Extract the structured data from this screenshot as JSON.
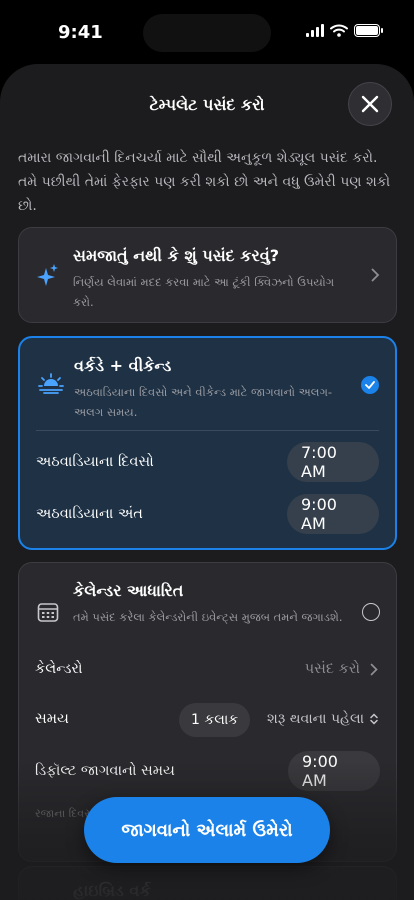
{
  "status_bar": {
    "time": "9:41"
  },
  "sheet": {
    "title": "ટેમ્પલેટ પસંદ કરો",
    "description": "તમારા જાગવાની દિનચર્યા માટે સૌથી અનુકૂળ શેડ્યૂલ પસંદ કરો. તમે પછીથી તેમાં ફેરફાર પણ કરી શકો છો અને વધુ ઉમેરી પણ શકો છો."
  },
  "cards": {
    "help": {
      "title": "સમજાતું નથી કે શું પસંદ કરવું?",
      "subtitle": "નિર્ણય લેવામાં મદદ કરવા માટે આ ટૂંકી ક્વિઝનો ઉપયોગ કરો."
    },
    "weekday": {
      "title": "વર્કડે + વીકેન્ડ",
      "subtitle": "અઠવાડિયાના દિવસો અને વીકેન્ડ માટે જાગવાનો અલગ-અલગ સમય.",
      "rows": [
        {
          "label": "અઠવાડિયાના દિવસો",
          "value": "7:00 AM"
        },
        {
          "label": "અઠવાડિયાના અંત",
          "value": "9:00 AM"
        }
      ]
    },
    "calendar": {
      "title": "કેલેન્ડર આધારિત",
      "subtitle": "તમે પસંદ કરેલા કેલેન્ડરોની ઇવેન્ટ્સ મુજબ તમને જગાડશે.",
      "calendars_label": "કેલેન્ડરો",
      "calendars_value": "પસંદ કરો",
      "time_label": "સમય",
      "time_value": "1 કલાક",
      "time_suffix": "શરૂ થવાના પહેલા",
      "default_label": "ડિફૉલ્ટ જાગવાનો સમય",
      "default_value": "9:00 AM",
      "footer_partial": "રજાના દિવસ"
    },
    "hybrid": {
      "title": "હાઇબ્રિડ વર્ક"
    }
  },
  "cta_label": "જાગવાનો એલાર્મ ઉમેરો",
  "colors": {
    "accent": "#1a82e8",
    "sheet_bg": "#1c1c1e",
    "card_bg": "#2a2a2e",
    "selected_bg": "#1e3145"
  }
}
